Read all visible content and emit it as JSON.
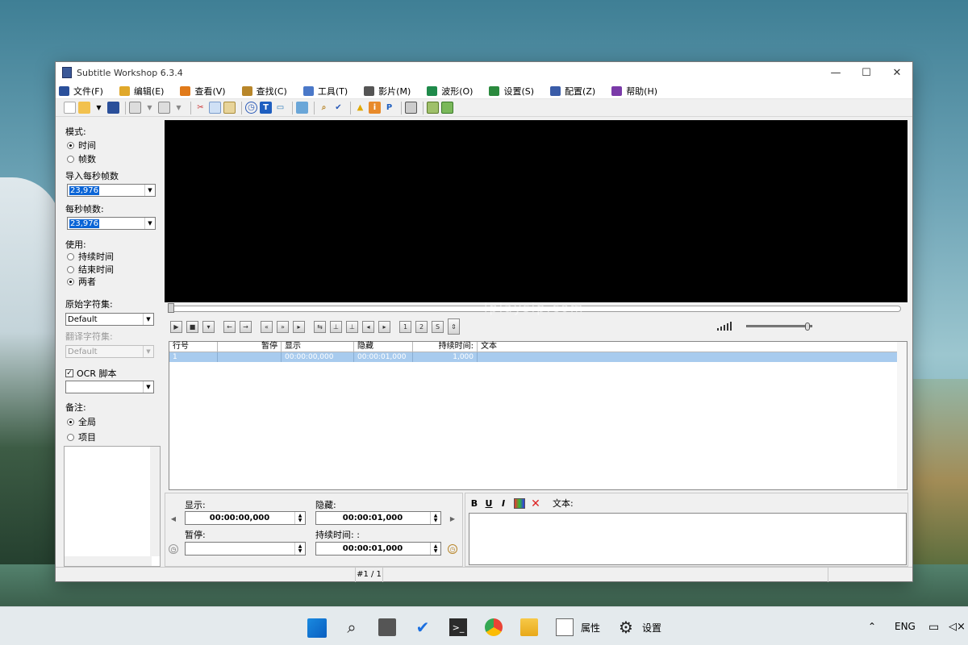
{
  "window": {
    "title": "Subtitle Workshop 6.3.4",
    "minimize": "—",
    "maximize": "☐",
    "close": "✕"
  },
  "menu": [
    {
      "label": "文件(F)",
      "icon": "save-disk-icon",
      "color": "#2a4f9a"
    },
    {
      "label": "编辑(E)",
      "icon": "pencil-note-icon",
      "color": "#e0a82a"
    },
    {
      "label": "查看(V)",
      "icon": "eye-icon",
      "color": "#e07a1a"
    },
    {
      "label": "查找(C)",
      "icon": "magnifier-icon",
      "color": "#b8862a"
    },
    {
      "label": "工具(T)",
      "icon": "wrench-icon",
      "color": "#4a78c8"
    },
    {
      "label": "影片(M)",
      "icon": "film-icon",
      "color": "#555555"
    },
    {
      "label": "波形(O)",
      "icon": "waveform-icon",
      "color": "#1f8a4a"
    },
    {
      "label": "设置(S)",
      "icon": "settings-check-icon",
      "color": "#2b8a3e"
    },
    {
      "label": "配置(Z)",
      "icon": "profile-swap-icon",
      "color": "#3a5ca8"
    },
    {
      "label": "帮助(H)",
      "icon": "help-book-icon",
      "color": "#7a3aa8"
    }
  ],
  "left": {
    "mode_label": "模式:",
    "mode_time": "时间",
    "mode_frames": "帧数",
    "input_fps_label": "导入每秒帧数",
    "input_fps_value": "23,976",
    "fps_label": "每秒帧数:",
    "fps_value": "23,976",
    "use_label": "使用:",
    "use_duration": "持续时间",
    "use_end": "结束时间",
    "use_both": "两者",
    "orig_charset_label": "原始字符集:",
    "orig_charset_value": "Default",
    "trans_charset_label": "翻译字符集:",
    "trans_charset_value": "Default",
    "ocr_label": "OCR 脚本",
    "notes_label": "备注:",
    "notes_global": "全局",
    "notes_item": "项目"
  },
  "grid": {
    "headers": [
      "行号",
      "暂停",
      "显示",
      "隐藏",
      "持续时间:",
      "文本"
    ],
    "rows": [
      [
        "1",
        "",
        "00:00:00,000",
        "00:00:01,000",
        "1,000",
        ""
      ]
    ]
  },
  "edit": {
    "show_label": "显示:",
    "show_value": "00:00:00,000",
    "hide_label": "隐藏:",
    "hide_value": "00:00:01,000",
    "pause_label": "暂停:",
    "pause_value": "",
    "duration_label": "持续时间: :",
    "duration_value": "00:00:01,000"
  },
  "textpanel": {
    "bold": "B",
    "underline": "U",
    "italic": "I",
    "label": "文本:"
  },
  "status": {
    "position": "#1 / 1"
  },
  "watermark": "lplaysip.com",
  "taskbar": {
    "item1_label": "属性",
    "item2_label": "设置",
    "lang": "ENG"
  },
  "playback": {
    "seek_position": 0,
    "volume": 0.92
  }
}
